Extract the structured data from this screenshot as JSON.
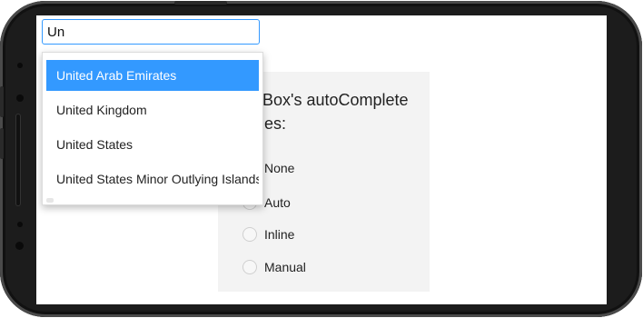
{
  "search": {
    "value": "Un"
  },
  "dropdown": {
    "items": [
      {
        "label": "United Arab Emirates",
        "selected": true
      },
      {
        "label": "United Kingdom",
        "selected": false
      },
      {
        "label": "United States",
        "selected": false
      },
      {
        "label": "United States Minor Outlying Islands",
        "selected": false
      }
    ]
  },
  "panel": {
    "title": "TextBox's autoComplete modes:",
    "options": [
      {
        "label": "None",
        "checked": false
      },
      {
        "label": "Auto",
        "checked": false
      },
      {
        "label": "Inline",
        "checked": false
      },
      {
        "label": "Manual",
        "checked": false
      }
    ]
  },
  "colors": {
    "accent": "#3399ff",
    "panel_bg": "#f3f3f3",
    "frame": "#1c1c1c"
  }
}
